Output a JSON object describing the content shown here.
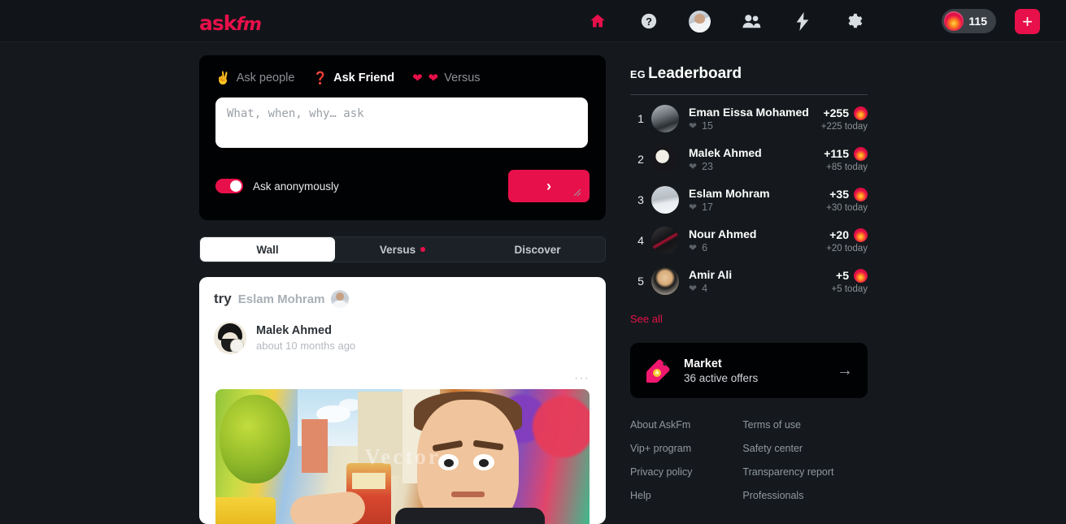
{
  "header": {
    "logo_text": "ask",
    "logo_suffix": "fm",
    "nav": [
      {
        "name": "home-icon",
        "label": "Home",
        "active": true
      },
      {
        "name": "help-icon",
        "label": "Help",
        "active": false
      },
      {
        "name": "profile-avatar",
        "label": "Profile",
        "active": false
      },
      {
        "name": "friends-icon",
        "label": "Friends",
        "active": false
      },
      {
        "name": "lightning-icon",
        "label": "Shoutouts",
        "active": false
      },
      {
        "name": "gear-icon",
        "label": "Settings",
        "active": false
      }
    ],
    "coin_count": "115",
    "plus_label": "+"
  },
  "composer": {
    "tabs": [
      {
        "emoji": "✌",
        "label": "Ask people",
        "active": false
      },
      {
        "emoji": "❓",
        "label": "Ask Friend",
        "active": true
      },
      {
        "emoji": "❤❤",
        "label": "Versus",
        "active": false
      }
    ],
    "input_value": "",
    "input_placeholder": "What, when, why… ask",
    "anonymous_label": "Ask anonymously",
    "anonymous_on": true,
    "send_label": "›"
  },
  "feed_tabs": [
    {
      "label": "Wall",
      "active": true,
      "dot": false
    },
    {
      "label": "Versus",
      "active": false,
      "dot": true
    },
    {
      "label": "Discover",
      "active": false,
      "dot": false
    }
  ],
  "post": {
    "try_word": "try",
    "try_name": "Eslam Mohram",
    "author_name": "Malek Ahmed",
    "timestamp": "about 10 months ago",
    "menu_label": "···",
    "image_watermark": "Vector"
  },
  "leaderboard": {
    "region": "EG",
    "title": "Leaderboard",
    "see_all": "See all",
    "rows": [
      {
        "rank": "1",
        "name": "Eman Eissa Mohamed",
        "hearts": "15",
        "score": "+255",
        "today": "+225 today"
      },
      {
        "rank": "2",
        "name": "Malek Ahmed",
        "hearts": "23",
        "score": "+115",
        "today": "+85 today"
      },
      {
        "rank": "3",
        "name": "Eslam Mohram",
        "hearts": "17",
        "score": "+35",
        "today": "+30 today"
      },
      {
        "rank": "4",
        "name": "Nour Ahmed",
        "hearts": "6",
        "score": "+20",
        "today": "+20 today"
      },
      {
        "rank": "5",
        "name": "Amir Ali",
        "hearts": "4",
        "score": "+5",
        "today": "+5 today"
      }
    ]
  },
  "market": {
    "title": "Market",
    "subtitle": "36 active offers",
    "arrow": "→"
  },
  "footer": {
    "col1": [
      "About AskFm",
      "Vip+ program",
      "Privacy policy",
      "Help"
    ],
    "col2": [
      "Terms of use",
      "Safety center",
      "Transparency report",
      "Professionals"
    ]
  },
  "colors": {
    "brand_red": "#e8104a",
    "page_bg": "#15191d",
    "header_bg": "#11151a",
    "card_black": "#010204",
    "white": "#ffffff"
  }
}
